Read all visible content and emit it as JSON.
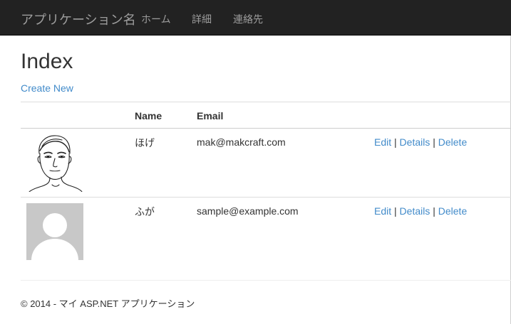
{
  "navbar": {
    "brand": "アプリケーション名",
    "links": [
      "ホーム",
      "詳細",
      "連絡先"
    ]
  },
  "page": {
    "title": "Index",
    "create_link": "Create New"
  },
  "table": {
    "headers": {
      "name": "Name",
      "email": "Email"
    },
    "rows": [
      {
        "avatar": "sketch-portrait",
        "name": "ほげ",
        "email": "mak@makcraft.com",
        "actions": [
          "Edit",
          "Details",
          "Delete"
        ],
        "separator": "|"
      },
      {
        "avatar": "default-user-placeholder",
        "name": "ふが",
        "email": "sample@example.com",
        "actions": [
          "Edit",
          "Details",
          "Delete"
        ],
        "separator": "|"
      }
    ]
  },
  "footer": {
    "text": "© 2014 - マイ ASP.NET アプリケーション"
  },
  "colors": {
    "navbar_bg": "#222222",
    "nav_text": "#9d9d9d",
    "link": "#428bca",
    "placeholder": "#c8c8c8"
  }
}
